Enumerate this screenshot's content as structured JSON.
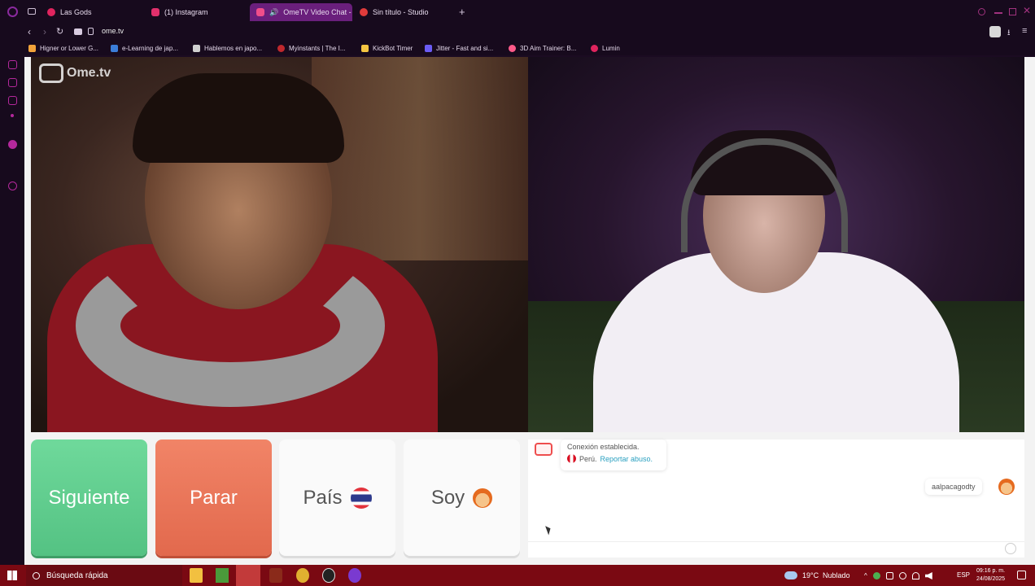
{
  "tabs": [
    {
      "title": "Las Gods",
      "color": "#e0245e"
    },
    {
      "title": "(1) Instagram",
      "color": "#e1306c"
    },
    {
      "title": "OmeTV Video Chat -",
      "color": "#f04e8a"
    },
    {
      "title": "Sin título - Studio",
      "color": "#e03b3b"
    }
  ],
  "new_tab": "+",
  "address": {
    "url": "ome.tv"
  },
  "bookmarks": [
    {
      "title": "Higner or Lower G...",
      "color": "#f2a33a"
    },
    {
      "title": "e-Learning de jap...",
      "color": "#3b7dd8"
    },
    {
      "title": "Hablemos en japo...",
      "color": "#d0d0d0"
    },
    {
      "title": "Myinstants | The I...",
      "color": "#c0282d"
    },
    {
      "title": "KickBot Timer",
      "color": "#f5c542"
    },
    {
      "title": "Jitter - Fast and si...",
      "color": "#6b5cf5"
    },
    {
      "title": "3D Aim Trainer: B...",
      "color": "#ff5a8a"
    },
    {
      "title": "Lumin",
      "color": "#e0245e"
    }
  ],
  "logo": "Ome.tv",
  "buttons": {
    "next": "Siguiente",
    "stop": "Parar",
    "country": "País",
    "soy": "Soy"
  },
  "chat": {
    "status": "Conexión establecida.",
    "country": "Perú.",
    "report": "Reportar abuso.",
    "username": "aalpacagodty"
  },
  "taskbar": {
    "search": "Búsqueda rápida",
    "weather": "19°C",
    "weather_desc": "Nublado",
    "lang": "ESP",
    "time": "09:16 p. m.",
    "date": "24/08/2025"
  },
  "colors": {
    "accent": "#6a1f7c",
    "next": "#5fcb8c",
    "stop": "#e8704f",
    "taskbar": "#7a0912"
  }
}
